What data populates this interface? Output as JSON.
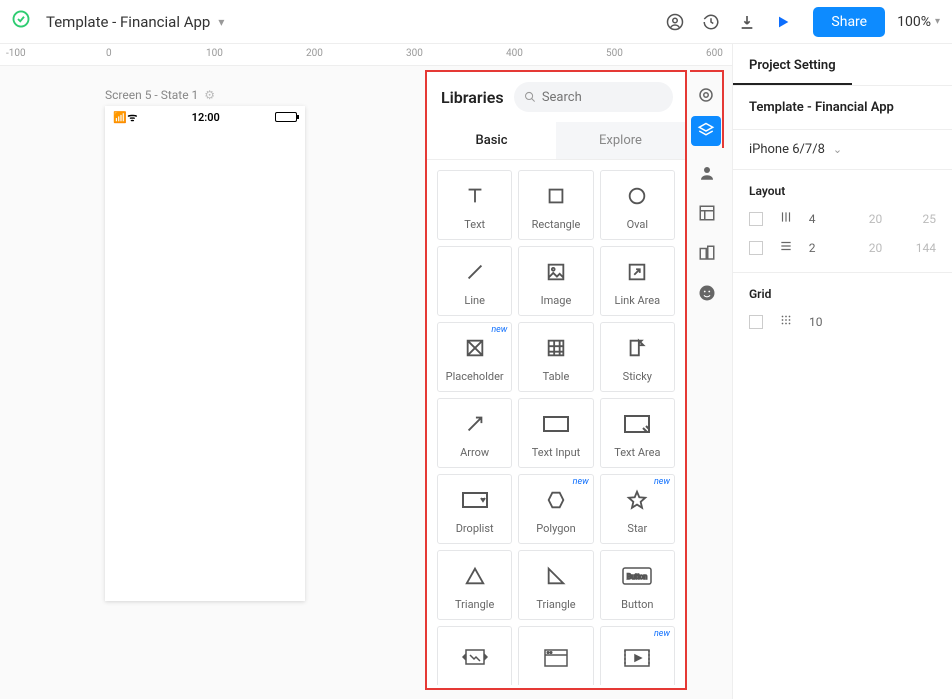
{
  "header": {
    "project_name": "Template - Financial App",
    "share_label": "Share",
    "zoom": "100%"
  },
  "ruler": {
    "marks": [
      "-100",
      "0",
      "100",
      "200",
      "300",
      "400",
      "500",
      "600"
    ]
  },
  "canvas": {
    "screen_label": "Screen 5 - State 1",
    "phone_time": "12:00"
  },
  "libraries": {
    "title": "Libraries",
    "search_placeholder": "Search",
    "tabs": {
      "basic": "Basic",
      "explore": "Explore"
    },
    "items": [
      {
        "label": "Text",
        "new": false
      },
      {
        "label": "Rectangle",
        "new": false
      },
      {
        "label": "Oval",
        "new": false
      },
      {
        "label": "Line",
        "new": false
      },
      {
        "label": "Image",
        "new": false
      },
      {
        "label": "Link Area",
        "new": false
      },
      {
        "label": "Placeholder",
        "new": true
      },
      {
        "label": "Table",
        "new": false
      },
      {
        "label": "Sticky",
        "new": false
      },
      {
        "label": "Arrow",
        "new": false
      },
      {
        "label": "Text Input",
        "new": false
      },
      {
        "label": "Text Area",
        "new": false
      },
      {
        "label": "Droplist",
        "new": false
      },
      {
        "label": "Polygon",
        "new": true
      },
      {
        "label": "Star",
        "new": true
      },
      {
        "label": "Triangle",
        "new": false
      },
      {
        "label": "Triangle",
        "new": false
      },
      {
        "label": "Button",
        "new": false
      },
      {
        "label": "",
        "new": false
      },
      {
        "label": "",
        "new": false
      },
      {
        "label": "",
        "new": true
      }
    ]
  },
  "props": {
    "tab": "Project Setting",
    "project_title": "Template - Financial App",
    "device": "iPhone 6/7/8",
    "layout_label": "Layout",
    "layout_rows": [
      {
        "v1": "4",
        "v2": "20",
        "v3": "25"
      },
      {
        "v1": "2",
        "v2": "20",
        "v3": "144"
      }
    ],
    "grid_label": "Grid",
    "grid_value": "10"
  }
}
